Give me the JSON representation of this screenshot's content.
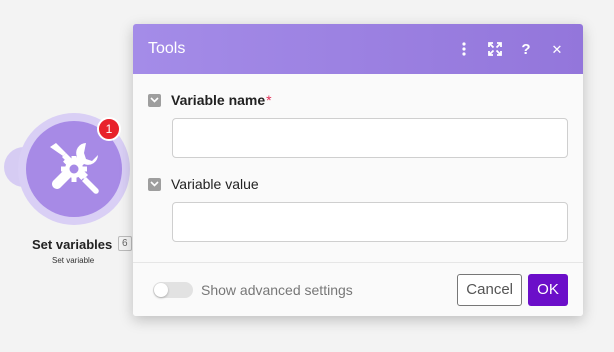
{
  "colors": {
    "accent": "#6b0ec9",
    "header": "#9d84e4",
    "module": "#a78ae6",
    "badge": "#e8212b",
    "required": "#e22f56"
  },
  "module": {
    "icon": "tools-icon",
    "title": "Set variables",
    "id": "6",
    "subtitle": "Set variable",
    "badge": "1"
  },
  "dialog": {
    "title": "Tools",
    "header_icons": [
      "more-vertical-icon",
      "expand-icon",
      "help-icon",
      "close-icon"
    ],
    "help_glyph": "?",
    "close_glyph": "✕",
    "fields": [
      {
        "label": "Variable name",
        "required_marker": "*",
        "value": "",
        "placeholder": ""
      },
      {
        "label": "Variable value",
        "value": "",
        "placeholder": ""
      }
    ],
    "advanced_label": "Show advanced settings",
    "advanced_enabled": false,
    "cancel_label": "Cancel",
    "ok_label": "OK"
  }
}
